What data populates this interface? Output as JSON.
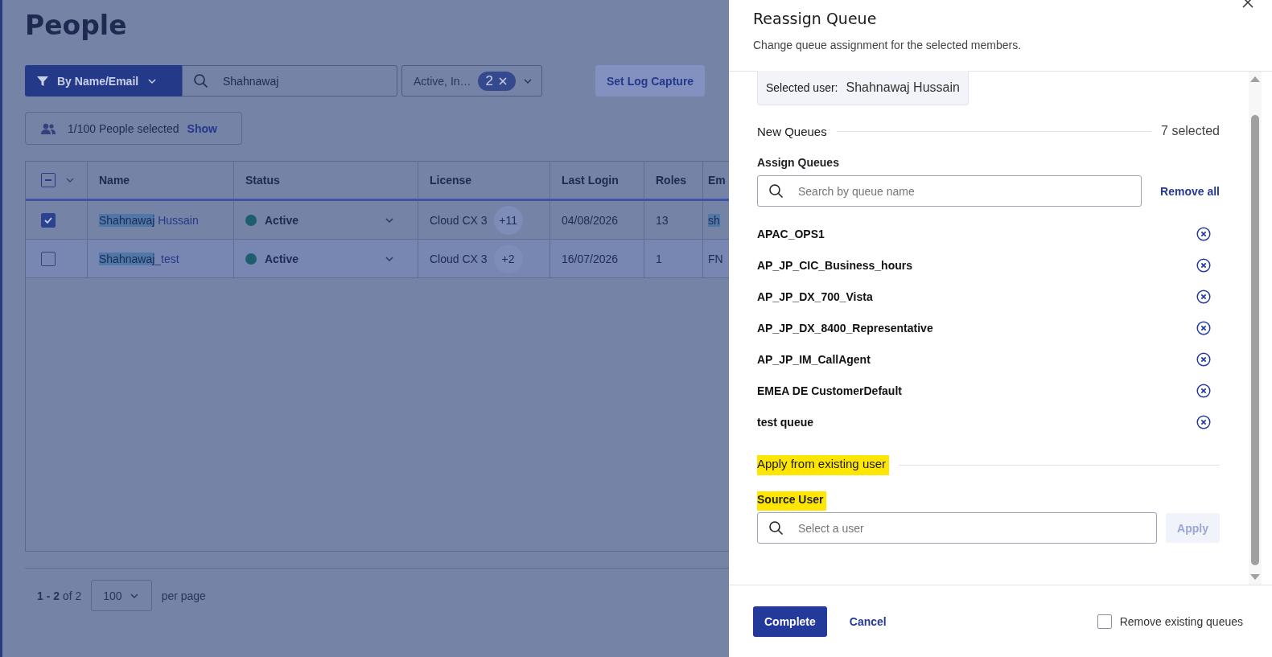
{
  "page": {
    "title": "People"
  },
  "toolbar": {
    "filter_mode": "By Name/Email",
    "search": {
      "value": "Shahnawaj"
    },
    "status_filter": {
      "value": "Active, In…",
      "count": "2"
    },
    "buttons": [
      "Set Log Capture"
    ]
  },
  "selection": {
    "text": "1/100 People selected",
    "action": "Show"
  },
  "table": {
    "header_checkbox": {
      "indeterminate": true
    },
    "columns": [
      "Name",
      "Status",
      "License",
      "Last Login",
      "Roles",
      "Em"
    ],
    "rows": [
      {
        "checked": true,
        "name_match": "Shahnawaj",
        "name_rest": " Hussain",
        "status": "Active",
        "license": "Cloud CX 3",
        "license_extra": "+11",
        "last_login": "04/08/2026",
        "roles": "13",
        "column_6": "sh"
      },
      {
        "checked": false,
        "name_match": "Shahnawaj",
        "name_rest": "_test",
        "status": "Active",
        "license": "Cloud CX 3",
        "license_extra": "+2",
        "last_login": "16/07/2026",
        "roles": "1",
        "column_6": "FN"
      }
    ]
  },
  "pagination": {
    "range": "**1 - 2** of 2",
    "page_size": "100",
    "suffix": "per page"
  },
  "drawer": {
    "title": "Reassign Queue",
    "subtitle": "Change queue assignment for the selected members.",
    "selected_user": {
      "label": "Selected user:",
      "value": "Shahnawaj Hussain"
    },
    "new_queues": {
      "heading": "New Queues",
      "count": "7 selected"
    },
    "assign": {
      "label": "Assign Queues",
      "placeholder": "Search by queue name",
      "action": "Remove all"
    },
    "queues": [
      "APAC_OPS1",
      "AP_JP_CIC_Business_hours",
      "AP_JP_DX_700_Vista",
      "AP_JP_DX_8400_Representative",
      "AP_JP_IM_CallAgent",
      "EMEA DE CustomerDefault",
      "test queue"
    ],
    "apply_section": {
      "heading": "Apply from existing user",
      "heading_highlighted": true,
      "source_label": "Source User",
      "source_highlighted": true,
      "placeholder": "Select a user",
      "button": {
        "label": "Apply",
        "disabled": true
      }
    },
    "footer": {
      "primary": "Complete",
      "secondary": "Cancel",
      "checkbox": {
        "label": "Remove existing queues",
        "checked": false
      }
    }
  }
}
